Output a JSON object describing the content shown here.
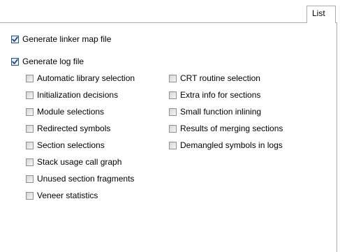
{
  "tab": {
    "label": "List"
  },
  "options": {
    "linker_map": {
      "label": "Generate linker map file",
      "checked": true
    },
    "log_file": {
      "label": "Generate log file",
      "checked": true
    }
  },
  "log_options": {
    "left": [
      {
        "label": "Automatic library selection",
        "checked": false
      },
      {
        "label": "Initialization decisions",
        "checked": false
      },
      {
        "label": "Module selections",
        "checked": false
      },
      {
        "label": "Redirected symbols",
        "checked": false
      },
      {
        "label": "Section selections",
        "checked": false
      },
      {
        "label": "Stack usage call graph",
        "checked": false
      },
      {
        "label": "Unused section fragments",
        "checked": false
      },
      {
        "label": "Veneer statistics",
        "checked": false
      }
    ],
    "right": [
      {
        "label": "CRT routine selection",
        "checked": false
      },
      {
        "label": "Extra info for sections",
        "checked": false
      },
      {
        "label": "Small function inlining",
        "checked": false
      },
      {
        "label": "Results of merging sections",
        "checked": false
      },
      {
        "label": "Demangled symbols in logs",
        "checked": false
      }
    ]
  },
  "colors": {
    "border": "#adadad",
    "checkbox_border": "#8e8f8f",
    "checked_border": "#1c5180",
    "check_mark": "#2b3f6b"
  }
}
